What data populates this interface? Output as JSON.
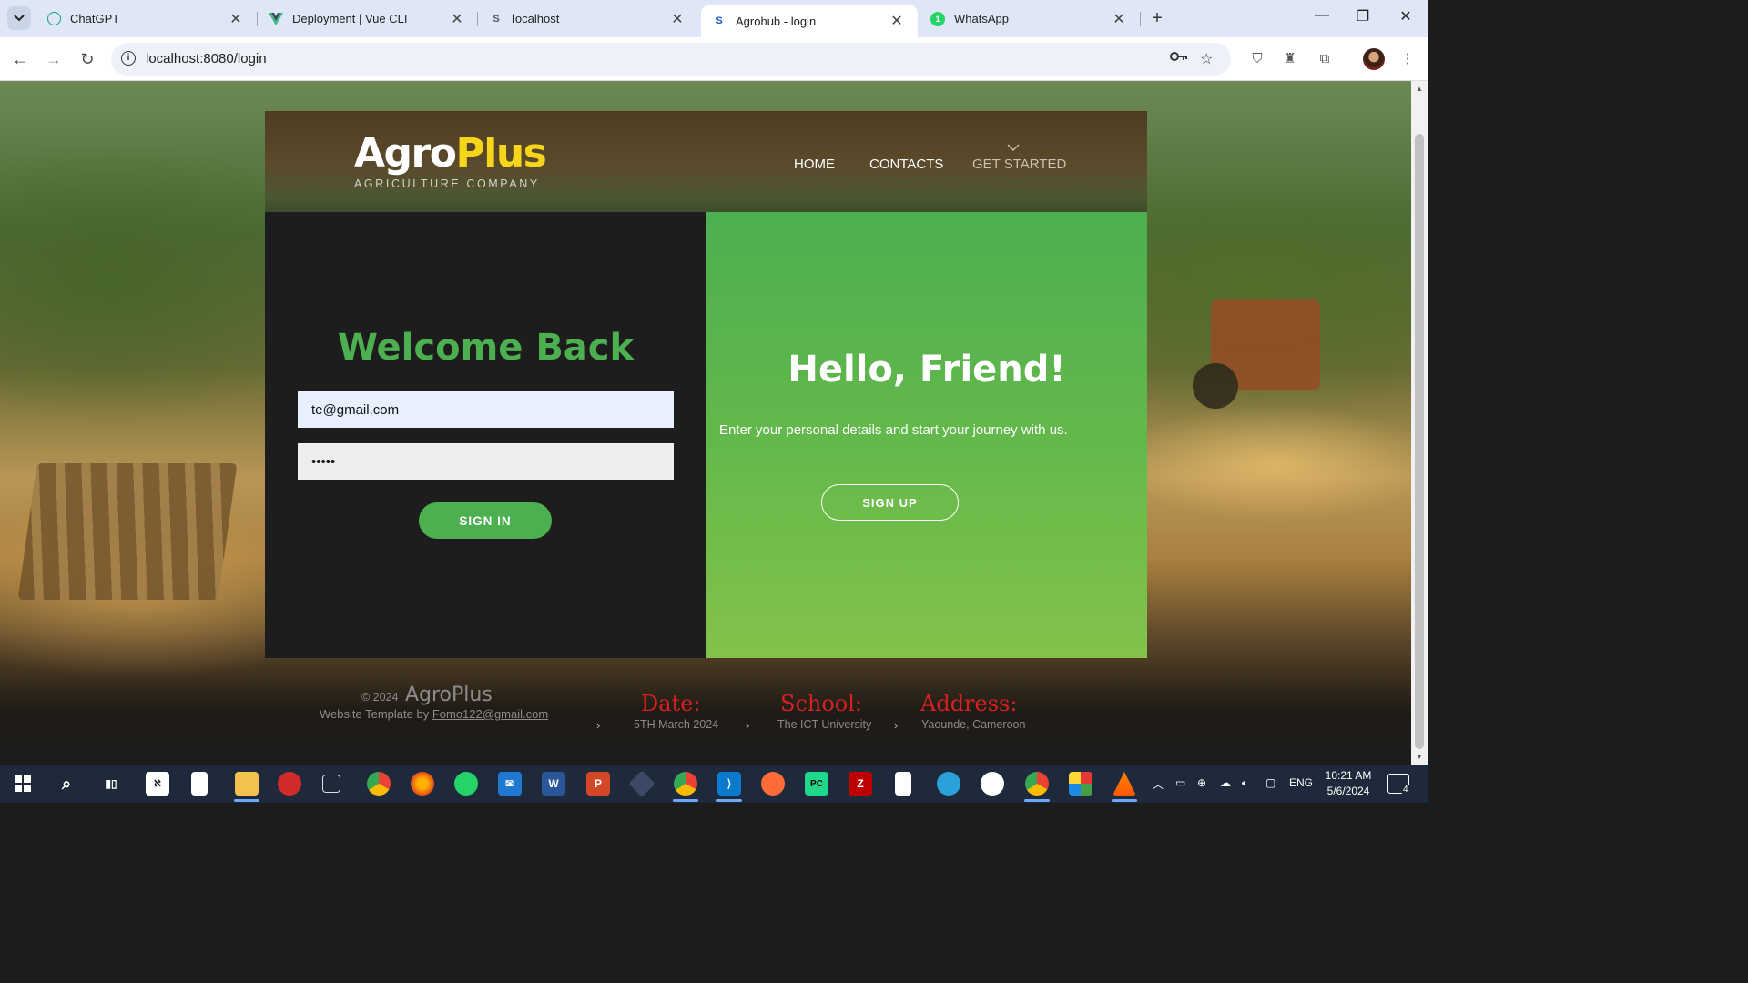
{
  "browser": {
    "tabs": [
      {
        "title": "ChatGPT",
        "icon": "chatgpt-icon",
        "active": false
      },
      {
        "title": "Deployment | Vue CLI",
        "icon": "vue-icon",
        "active": false
      },
      {
        "title": "localhost",
        "icon": "s-icon",
        "active": false
      },
      {
        "title": "Agrohub - login",
        "icon": "s-icon",
        "active": true
      },
      {
        "title": "WhatsApp",
        "icon": "whatsapp-icon",
        "active": false,
        "badge": "1"
      }
    ],
    "favicon_s": "S",
    "url": "localhost:8080/login"
  },
  "site": {
    "logo": {
      "part1": "Agro",
      "part2": "Plus",
      "subtitle": "AGRICULTURE COMPANY"
    },
    "nav": {
      "home": "HOME",
      "contacts": "CONTACTS",
      "get_started": "GET STARTED"
    },
    "login": {
      "heading": "Welcome Back",
      "email_value": "te@gmail.com",
      "password_value": "•••••",
      "signin_label": "SIGN IN"
    },
    "signup": {
      "heading": "Hello, Friend!",
      "tagline": "Enter your personal details and start your journey with us.",
      "signup_label": "SIGN UP"
    },
    "footer": {
      "copyright": "© 2024",
      "brand": "AgroPlus",
      "template_prefix": "Website Template by",
      "template_email": "Fomo122@gmail.com",
      "date_heading": "Date:",
      "date_value": "5TH March 2024",
      "school_heading": "School:",
      "school_value": "The ICT University",
      "address_heading": "Address:",
      "address_value": "Yaounde, Cameroon"
    }
  },
  "taskbar": {
    "language": "ENG",
    "time": "10:21 AM",
    "date": "5/6/2024",
    "notifications": "4"
  },
  "colors": {
    "brand_green": "#4caf50",
    "logo_yellow": "#f5d61a",
    "footer_heading_red": "#d72020"
  }
}
